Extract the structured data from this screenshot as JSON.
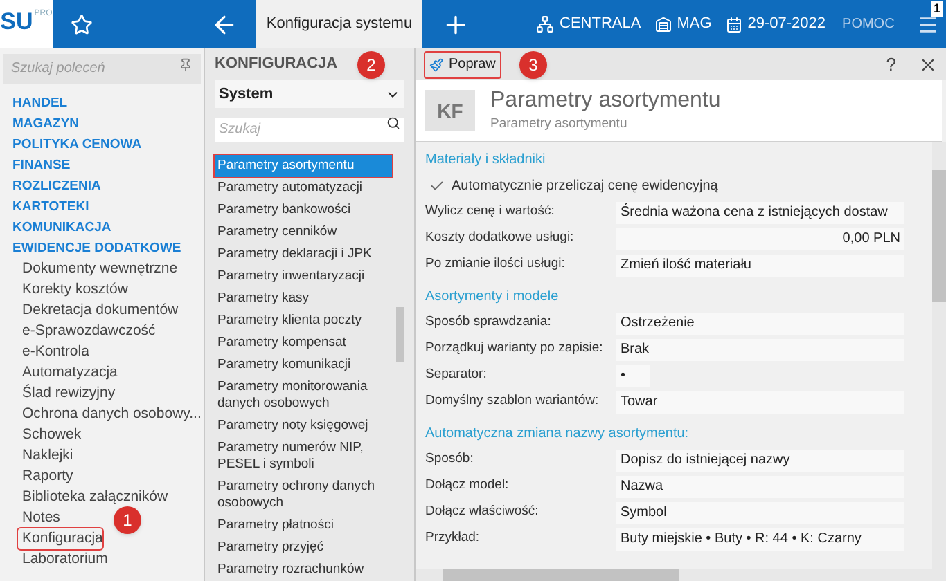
{
  "topbar": {
    "logo": "SU",
    "logo_sup": "PRO",
    "tab": "Konfiguracja systemu",
    "branch": "CENTRALA",
    "warehouse": "MAG",
    "date": "29-07-2022",
    "help": "POMOC",
    "badge": "1"
  },
  "sidebar": {
    "search_placeholder": "Szukaj poleceń",
    "items": [
      {
        "label": "HANDEL",
        "kind": "header",
        "highlighted": false
      },
      {
        "label": "MAGAZYN",
        "kind": "header",
        "highlighted": false
      },
      {
        "label": "POLITYKA CENOWA",
        "kind": "header",
        "highlighted": false
      },
      {
        "label": "FINANSE",
        "kind": "header",
        "highlighted": false
      },
      {
        "label": "ROZLICZENIA",
        "kind": "header",
        "highlighted": false
      },
      {
        "label": "KARTOTEKI",
        "kind": "header",
        "highlighted": false
      },
      {
        "label": "KOMUNIKACJA",
        "kind": "header",
        "highlighted": false
      },
      {
        "label": "EWIDENCJE DODATKOWE",
        "kind": "header",
        "highlighted": false
      },
      {
        "label": "Dokumenty wewnętrzne",
        "kind": "item",
        "highlighted": false
      },
      {
        "label": "Korekty kosztów",
        "kind": "item",
        "highlighted": false
      },
      {
        "label": "Dekretacja dokumentów",
        "kind": "item",
        "highlighted": false
      },
      {
        "label": "e-Sprawozdawczość",
        "kind": "item",
        "highlighted": false
      },
      {
        "label": "e-Kontrola",
        "kind": "item",
        "highlighted": false
      },
      {
        "label": "Automatyzacja",
        "kind": "item",
        "highlighted": false
      },
      {
        "label": "Ślad rewizyjny",
        "kind": "item",
        "highlighted": false
      },
      {
        "label": "Ochrona danych osobowy...",
        "kind": "item",
        "highlighted": false
      },
      {
        "label": "Schowek",
        "kind": "item",
        "highlighted": false
      },
      {
        "label": "Naklejki",
        "kind": "item",
        "highlighted": false
      },
      {
        "label": "Raporty",
        "kind": "item",
        "highlighted": false
      },
      {
        "label": "Biblioteka załączników",
        "kind": "item",
        "highlighted": false
      },
      {
        "label": "Notes",
        "kind": "item",
        "highlighted": false
      },
      {
        "label": "Konfiguracja",
        "kind": "item",
        "highlighted": true
      },
      {
        "label": "Laboratorium",
        "kind": "item",
        "highlighted": false
      }
    ]
  },
  "config": {
    "title": "KONFIGURACJA",
    "select": "System",
    "search_placeholder": "Szukaj",
    "items": [
      {
        "label": "Parametry asortymentu",
        "selected": true
      },
      {
        "label": "Parametry automatyzacji",
        "selected": false
      },
      {
        "label": "Parametry bankowości",
        "selected": false
      },
      {
        "label": "Parametry cenników",
        "selected": false
      },
      {
        "label": "Parametry deklaracji i JPK",
        "selected": false
      },
      {
        "label": "Parametry inwentaryzacji",
        "selected": false
      },
      {
        "label": "Parametry kasy",
        "selected": false
      },
      {
        "label": "Parametry klienta poczty",
        "selected": false
      },
      {
        "label": "Parametry kompensat",
        "selected": false
      },
      {
        "label": "Parametry komunikacji",
        "selected": false
      },
      {
        "label": "Parametry monitorowania danych osobowych",
        "selected": false
      },
      {
        "label": "Parametry noty księgowej",
        "selected": false
      },
      {
        "label": "Parametry numerów NIP, PESEL i symboli",
        "selected": false
      },
      {
        "label": "Parametry ochrony danych osobowych",
        "selected": false
      },
      {
        "label": "Parametry płatności",
        "selected": false
      },
      {
        "label": "Parametry przyjęć",
        "selected": false
      },
      {
        "label": "Parametry rozrachunków",
        "selected": false
      }
    ]
  },
  "panel": {
    "edit_button": "Popraw",
    "help": "?",
    "badge": "KF",
    "title": "Parametry asortymentu",
    "subtitle": "Parametry asortymentu",
    "sections": [
      {
        "title": "Materiały i składniki",
        "fields": [
          {
            "kind": "checkbox",
            "label": "Automatycznie przeliczaj cenę ewidencyjną",
            "checked": true
          },
          {
            "kind": "field",
            "label": "Wylicz cenę i wartość:",
            "value": "Średnia ważona cena z istniejących dostaw"
          },
          {
            "kind": "amount",
            "label": "Koszty dodatkowe usługi:",
            "value": "0,00 PLN"
          },
          {
            "kind": "field",
            "label": "Po zmianie ilości usługi:",
            "value": "Zmień ilość materiału"
          }
        ]
      },
      {
        "title": "Asortymenty i modele",
        "fields": [
          {
            "kind": "field",
            "label": "Sposób sprawdzania:",
            "value": "Ostrzeżenie"
          },
          {
            "kind": "field",
            "label": "Porządkuj warianty po zapisie:",
            "value": "Brak"
          },
          {
            "kind": "short",
            "label": "Separator:",
            "value": "•"
          },
          {
            "kind": "field",
            "label": "Domyślny szablon wariantów:",
            "value": "Towar"
          }
        ]
      },
      {
        "title": "Automatyczna zmiana nazwy asortymentu:",
        "fields": [
          {
            "kind": "field",
            "label": "Sposób:",
            "value": "Dopisz do istniejącej nazwy"
          },
          {
            "kind": "field",
            "label": "Dołącz model:",
            "value": "Nazwa"
          },
          {
            "kind": "field",
            "label": "Dołącz właściwość:",
            "value": "Symbol"
          },
          {
            "kind": "field",
            "label": "Przykład:",
            "value": "Buty miejskie • Buty • R: 44 • K: Czarny"
          }
        ]
      }
    ]
  },
  "callouts": [
    "1",
    "2",
    "3"
  ]
}
